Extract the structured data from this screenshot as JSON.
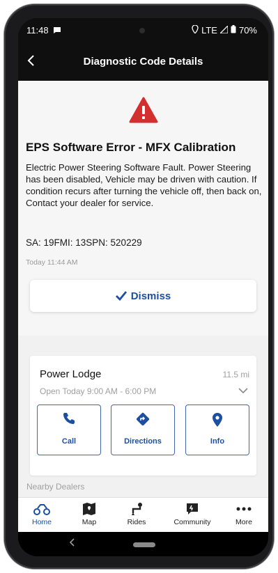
{
  "status_bar": {
    "time": "11:48",
    "network": "LTE",
    "battery": "70%"
  },
  "header": {
    "title": "Diagnostic Code Details"
  },
  "error": {
    "title": "EPS Software Error - MFX Calibration",
    "description": "Electric Power Steering Software Fault. Power Steering has been disabled, Vehicle may be driven with caution. If condition recurs after turning the vehicle off, then back on, Contact your dealer for service.",
    "codes": "SA: 19FMI: 13SPN: 520229",
    "timestamp": "Today 11:44 AM",
    "dismiss_label": "Dismiss"
  },
  "dealer": {
    "name": "Power Lodge",
    "distance": "11.5 mi",
    "hours": "Open Today  9:00 AM - 6:00 PM",
    "actions": [
      {
        "label": "Call",
        "icon": "phone-icon"
      },
      {
        "label": "Directions",
        "icon": "directions-icon"
      },
      {
        "label": "Info",
        "icon": "location-pin-icon"
      }
    ]
  },
  "nearby_label": "Nearby Dealers",
  "bottom_nav": [
    {
      "label": "Home",
      "icon": "atv-icon",
      "active": true
    },
    {
      "label": "Map",
      "icon": "map-icon"
    },
    {
      "label": "Rides",
      "icon": "route-icon"
    },
    {
      "label": "Community",
      "icon": "community-icon"
    },
    {
      "label": "More",
      "icon": "more-icon"
    }
  ],
  "colors": {
    "accent": "#1d4fa0",
    "warning": "#d32f2f",
    "header_bg": "#0f0f10"
  }
}
